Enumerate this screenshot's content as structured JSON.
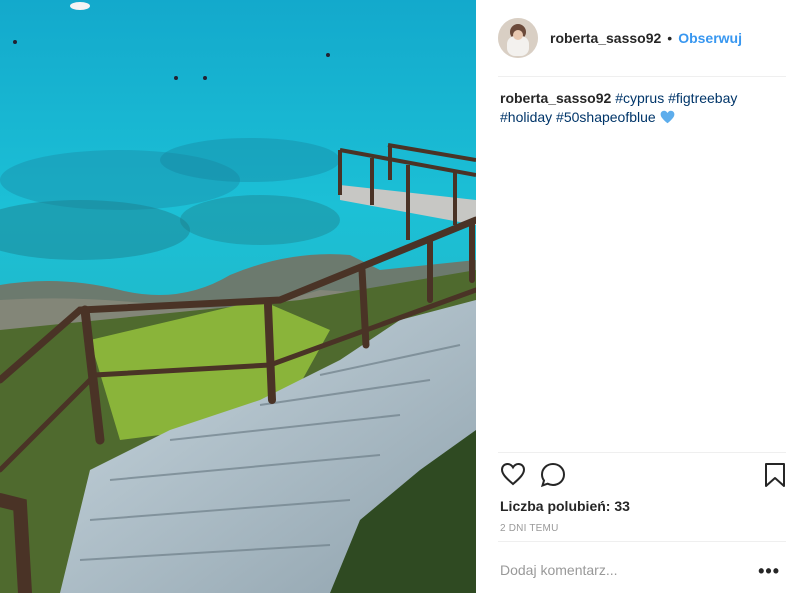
{
  "post": {
    "username": "roberta_sasso92",
    "separator": "•",
    "follow_label": "Obserwuj",
    "caption_username": "roberta_sasso92",
    "hashtags": [
      "#cyprus",
      "#figtreebay",
      "#holiday",
      "#50shapeofblue"
    ],
    "caption_emoji_icon": "blue-heart-icon",
    "likes_text": "Liczba polubień: 33",
    "time_text": "2 DNI TEMU",
    "comment_placeholder": "Dodaj komentarz...",
    "more_options": "•••"
  },
  "icons": {
    "like": "heart-outline-icon",
    "comment": "speech-bubble-icon",
    "save": "bookmark-icon",
    "more": "more-options-icon"
  },
  "colors": {
    "link": "#3897f0",
    "hashtag": "#003569",
    "text": "#262626",
    "muted": "#999999",
    "divider": "#efefef"
  }
}
